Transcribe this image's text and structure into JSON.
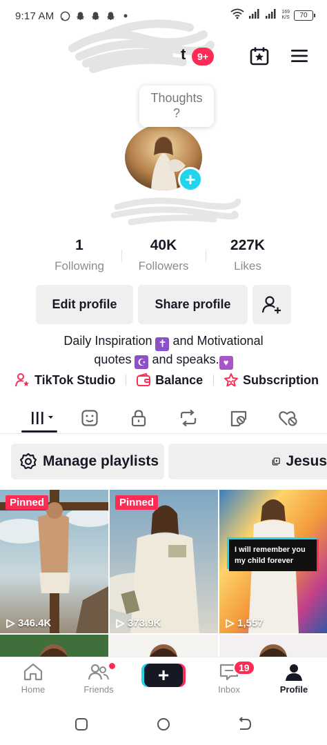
{
  "status_bar": {
    "time": "9:17 AM",
    "net_speed_value": "169",
    "net_speed_unit": "K/S",
    "battery": "70"
  },
  "header": {
    "username_fragment": "t",
    "badge": "9+",
    "icons": [
      "calendar-star-icon",
      "menu-icon"
    ]
  },
  "thought_bubble": {
    "line1": "Thoughts",
    "line2": "?"
  },
  "stats": [
    {
      "value": "1",
      "label": "Following"
    },
    {
      "value": "40K",
      "label": "Followers"
    },
    {
      "value": "227K",
      "label": "Likes"
    }
  ],
  "actions": {
    "edit_profile": "Edit profile",
    "share_profile": "Share profile"
  },
  "bio": {
    "line1_part1": "Daily Inspiration",
    "line1_emoji": "✝",
    "line1_part2": "and Motivational",
    "line2_part1": "quotes",
    "line2_emoji": "☪",
    "line2_part2": "and speaks.",
    "line2_emoji2": "♥"
  },
  "links": {
    "studio": "TikTok Studio",
    "balance": "Balance",
    "subscription": "Subscription"
  },
  "tabs": [
    "videos-grid-icon",
    "favorites-icon",
    "private-lock-icon",
    "reposts-icon",
    "hidden-videos-icon",
    "liked-icon"
  ],
  "playlists": {
    "manage": "Manage playlists",
    "playlist_name": "Jesus"
  },
  "videos": [
    {
      "pinned": "Pinned",
      "views": "346.4K"
    },
    {
      "pinned": "Pinned",
      "views": "373.9K"
    },
    {
      "caption": "I will remember you my child forever",
      "views": "1,557"
    }
  ],
  "bottom_nav": {
    "home": "Home",
    "friends": "Friends",
    "create": "+",
    "inbox": "Inbox",
    "inbox_badge": "19",
    "profile": "Profile"
  },
  "colors": {
    "accent_red": "#fe2c55",
    "accent_cyan": "#20d5ec",
    "text_primary": "#161823",
    "text_secondary": "#8a8b91"
  }
}
